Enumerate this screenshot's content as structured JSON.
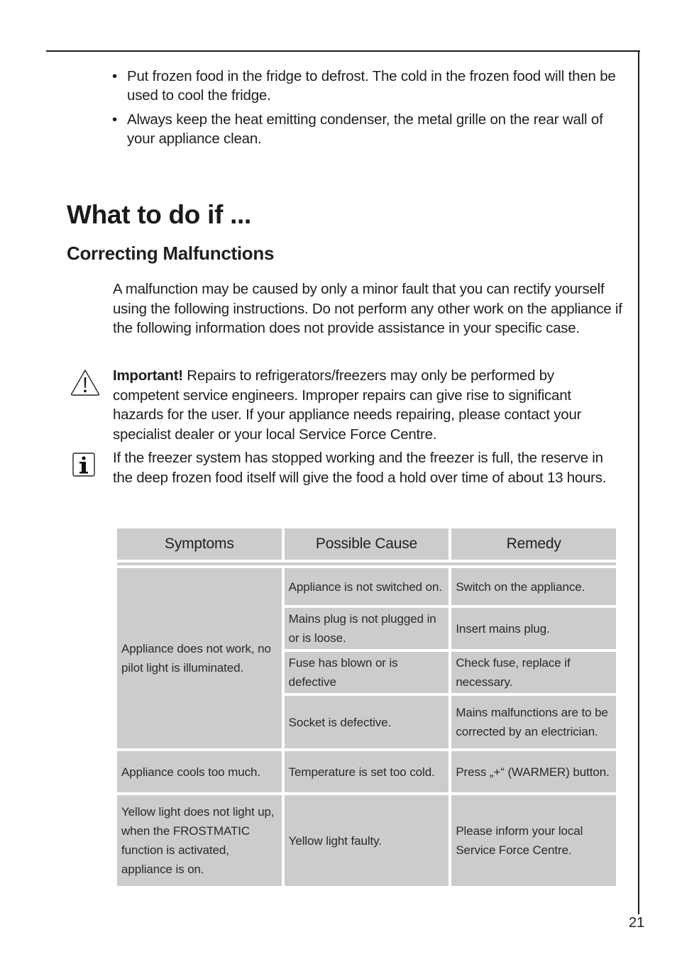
{
  "bullets": [
    "Put frozen food in the fridge to defrost. The cold in the frozen food will then be used to cool the fridge.",
    "Always keep the heat emitting condenser, the metal grille on the rear wall of your appliance clean."
  ],
  "bullet_glyph": "•",
  "heading": "What to do if ...",
  "subheading": "Correcting Malfunctions",
  "intro": "A malfunction may be caused by only a minor fault that you can rectify yourself using the following instructions. Do not perform any other work on the appliance if the following information does not provide assistance in your specific case.",
  "important": {
    "icon": "warning-triangle-icon",
    "label": "Important!",
    "text": " Repairs to refrigerators/freezers may only be performed by competent service engineers. Improper repairs can give rise to significant hazards for the user. If your appliance needs repairing, please contact your specialist dealer or your local Service Force Centre."
  },
  "info": {
    "icon": "info-icon",
    "text": "If the freezer system has stopped working and the freezer is full, the reserve in the deep frozen food itself will give the food a hold over time of about 13 hours."
  },
  "table": {
    "headers": [
      "Symptoms",
      "Possible Cause",
      "Remedy"
    ],
    "groups": [
      {
        "symptom": "Appliance does not work, no pilot light is illuminated.",
        "rows": [
          {
            "cause": "Appliance is not switched on.",
            "remedy": "Switch on the appliance."
          },
          {
            "cause": "Mains plug is not plugged in or is loose.",
            "remedy": "Insert mains plug."
          },
          {
            "cause": "Fuse has blown or is defective",
            "remedy": "Check fuse, replace if necessary."
          },
          {
            "cause": "Socket is defective.",
            "remedy": "Mains malfunctions are to be corrected by an electrician."
          }
        ]
      },
      {
        "symptom": "Appliance cools too much.",
        "rows": [
          {
            "cause": "Temperature is set too cold.",
            "remedy": "Press „+“ (WARMER) button."
          }
        ]
      },
      {
        "symptom": "Yellow light does not light up, when the FROSTMATIC function is activated, appliance is on.",
        "rows": [
          {
            "cause": "Yellow light faulty.",
            "remedy": "Please inform your local Service Force Centre."
          }
        ]
      }
    ]
  },
  "page_number": "21",
  "colors": {
    "table_cell_bg": "#cccccc",
    "text": "#1f1f1f",
    "rule": "#1a1a1a"
  }
}
